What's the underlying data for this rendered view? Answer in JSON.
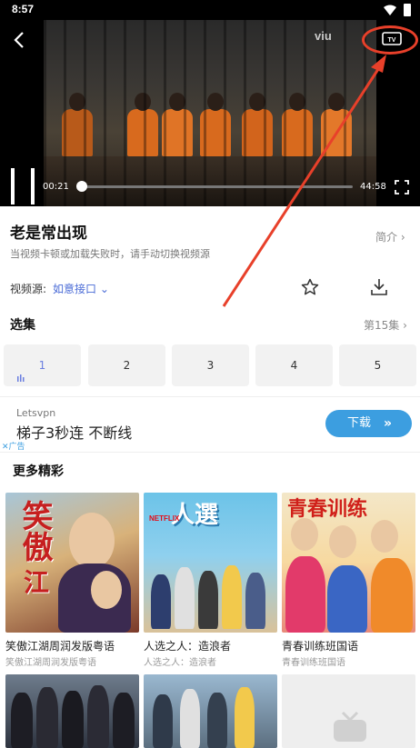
{
  "status_bar": {
    "time": "8:57"
  },
  "player": {
    "logo": "viu",
    "current_time": "00:21",
    "total_time": "44:58",
    "progress": 0.008
  },
  "show": {
    "title": "老是常出现",
    "intro_label": "简介",
    "tip": "当视频卡顿或加载失败时，请手动切换视频源",
    "source_label": "视频源:",
    "source_value": "如意接口"
  },
  "episodes": {
    "section_title": "选集",
    "count_label": "第15集",
    "items": [
      "1",
      "2",
      "3",
      "4",
      "5"
    ],
    "active_index": 0
  },
  "ad": {
    "brand": "Letsvpn",
    "slogan": "梯子3秒连 不断线",
    "button_label": "下载",
    "tag": "广告"
  },
  "more": {
    "section_title": "更多精彩",
    "cards": [
      {
        "name": "笑傲江湖周润发版粤语",
        "sub": "笑傲江湖周润发版粤语"
      },
      {
        "name": "人选之人：造浪者",
        "sub": "人选之人：造浪者",
        "badge": "NETFLIX"
      },
      {
        "name": "青春训练班国语",
        "sub": "青春训练班国语"
      }
    ]
  },
  "colors": {
    "accent": "#4a6bd6",
    "annotation": "#e8402a",
    "ad_button": "#3c9ee0"
  }
}
